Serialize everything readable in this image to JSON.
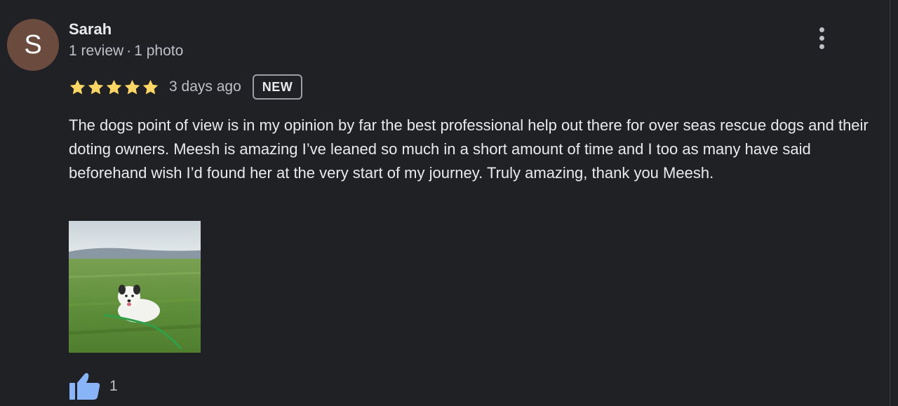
{
  "review": {
    "author": {
      "initial": "S",
      "name": "Sarah",
      "avatar_color": "#6b4b3e",
      "review_count": "1 review",
      "separator": "·",
      "photo_count": "1 photo"
    },
    "rating": {
      "stars": 5,
      "max": 5,
      "star_color": "#fdd663"
    },
    "date": "3 days ago",
    "badge": "NEW",
    "text": "The dogs point of view is in my opinion by far the best professional help out there for over seas rescue dogs and their doting owners. Meesh is amazing I’ve leaned so much in a short amount of time and I too as many have said beforehand wish I’d found her at the very start of my journey. Truly amazing, thank you Meesh.",
    "photos": [
      {
        "subject": "white dog sitting in green grass field"
      }
    ],
    "like": {
      "icon": "thumbs-up-icon",
      "count": "1",
      "icon_color": "#8ab4f8"
    },
    "more_icon": "more-vert-icon"
  }
}
